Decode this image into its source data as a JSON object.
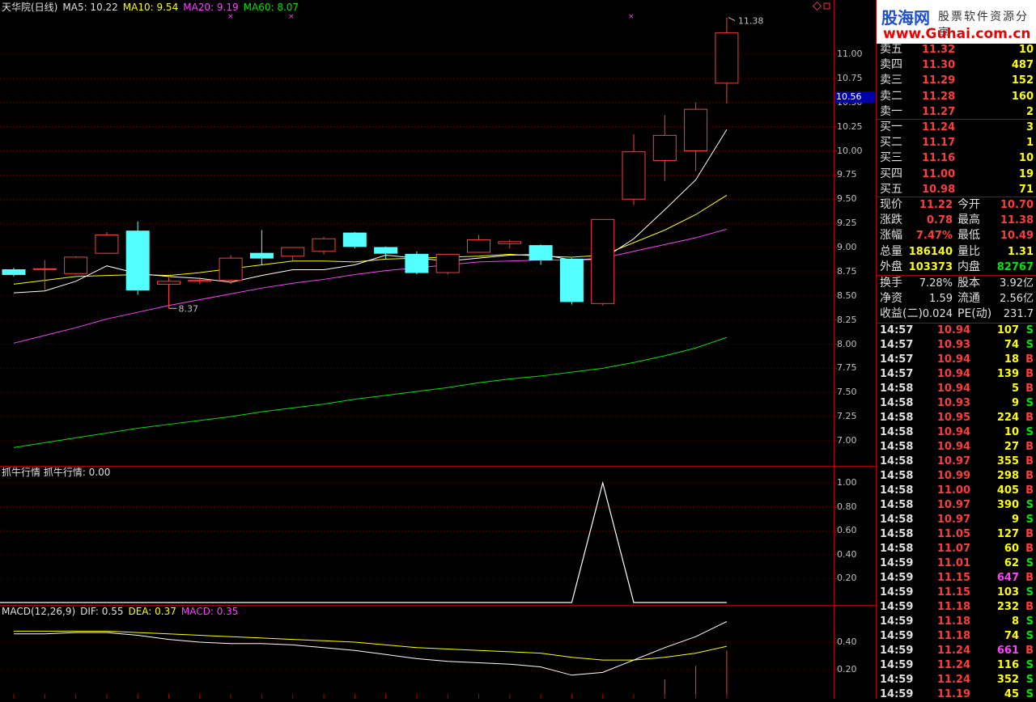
{
  "header": {
    "stock_label": "天华院(日线)",
    "ma5": "MA5: 10.22",
    "ma10": "MA10: 9.54",
    "ma20": "MA20: 9.19",
    "ma60": "MA60: 8.07"
  },
  "price_panel": {
    "y_ticks": [
      "11.00",
      "10.75",
      "10.50",
      "10.25",
      "10.00",
      "9.75",
      "9.50",
      "9.25",
      "9.00",
      "8.75",
      "8.50",
      "8.25",
      "8.00",
      "7.75",
      "7.50",
      "7.25",
      "7.00"
    ],
    "current_marker": "10.56",
    "high_label": "11.38",
    "low_label": "8.37",
    "colors": {
      "up": "#ff3c3c",
      "down": "#54ffff",
      "ma5": "#ffffff",
      "ma10": "#ffff00",
      "ma20": "#ff40ff",
      "ma60": "#00e600"
    }
  },
  "indicator_panel": {
    "title": "抓牛行情 抓牛行情: 0.00",
    "y_ticks": [
      "1.00",
      "0.80",
      "0.60",
      "0.40",
      "0.20"
    ]
  },
  "macd_panel": {
    "title_prefix": "MACD(12,26,9)",
    "dif": "DIF: 0.55",
    "dea": "DEA: 0.37",
    "macd": "MACD: 0.35",
    "y_ticks": [
      "0.40",
      "0.20"
    ]
  },
  "logo": {
    "brand": "股海网",
    "slogan": "股票软件资源分享",
    "url": "www.Guhai.com.cn"
  },
  "order_book": [
    {
      "label": "卖五",
      "price": "11.32",
      "vol": "10"
    },
    {
      "label": "卖四",
      "price": "11.30",
      "vol": "487"
    },
    {
      "label": "卖三",
      "price": "11.29",
      "vol": "152"
    },
    {
      "label": "卖二",
      "price": "11.28",
      "vol": "160"
    },
    {
      "label": "卖一",
      "price": "11.27",
      "vol": "2"
    },
    {
      "label": "买一",
      "price": "11.24",
      "vol": "3"
    },
    {
      "label": "买二",
      "price": "11.17",
      "vol": "1"
    },
    {
      "label": "买三",
      "price": "11.16",
      "vol": "10"
    },
    {
      "label": "买四",
      "price": "11.00",
      "vol": "19"
    },
    {
      "label": "买五",
      "price": "10.98",
      "vol": "71"
    }
  ],
  "stats": [
    {
      "l1": "现价",
      "v1": "11.22",
      "l2": "今开",
      "v2": "10.70"
    },
    {
      "l1": "涨跌",
      "v1": "0.78",
      "l2": "最高",
      "v2": "11.38"
    },
    {
      "l1": "涨幅",
      "v1": "7.47%",
      "l2": "最低",
      "v2": "10.49"
    },
    {
      "l1": "总量",
      "v1": "186140",
      "l2": "量比",
      "v2": "1.31"
    },
    {
      "l1": "外盘",
      "v1": "103373",
      "l2": "内盘",
      "v2": "82767"
    }
  ],
  "fundamentals": [
    {
      "l1": "换手",
      "v1": "7.28%",
      "l2": "股本",
      "v2": "3.92亿"
    },
    {
      "l1": "净资",
      "v1": "1.59",
      "l2": "流通",
      "v2": "2.56亿"
    },
    {
      "l1": "收益(二)",
      "v1": "0.024",
      "l2": "PE(动)",
      "v2": "231.7"
    }
  ],
  "ticks": [
    {
      "t": "14:57",
      "p": "10.94",
      "v": "107",
      "s": "S"
    },
    {
      "t": "14:57",
      "p": "10.93",
      "v": "74",
      "s": "S"
    },
    {
      "t": "14:57",
      "p": "10.94",
      "v": "18",
      "s": "B"
    },
    {
      "t": "14:57",
      "p": "10.94",
      "v": "139",
      "s": "B"
    },
    {
      "t": "14:58",
      "p": "10.94",
      "v": "5",
      "s": "B"
    },
    {
      "t": "14:58",
      "p": "10.93",
      "v": "9",
      "s": "S"
    },
    {
      "t": "14:58",
      "p": "10.95",
      "v": "224",
      "s": "B"
    },
    {
      "t": "14:58",
      "p": "10.94",
      "v": "10",
      "s": "S"
    },
    {
      "t": "14:58",
      "p": "10.94",
      "v": "27",
      "s": "B"
    },
    {
      "t": "14:58",
      "p": "10.97",
      "v": "355",
      "s": "B"
    },
    {
      "t": "14:58",
      "p": "10.99",
      "v": "298",
      "s": "B"
    },
    {
      "t": "14:58",
      "p": "11.00",
      "v": "405",
      "s": "B"
    },
    {
      "t": "14:58",
      "p": "10.97",
      "v": "390",
      "s": "S"
    },
    {
      "t": "14:58",
      "p": "10.97",
      "v": "9",
      "s": "S"
    },
    {
      "t": "14:58",
      "p": "11.05",
      "v": "127",
      "s": "B"
    },
    {
      "t": "14:58",
      "p": "11.07",
      "v": "60",
      "s": "B"
    },
    {
      "t": "14:59",
      "p": "11.01",
      "v": "62",
      "s": "S"
    },
    {
      "t": "14:59",
      "p": "11.15",
      "v": "647",
      "s": "B"
    },
    {
      "t": "14:59",
      "p": "11.15",
      "v": "103",
      "s": "S"
    },
    {
      "t": "14:59",
      "p": "11.18",
      "v": "232",
      "s": "B"
    },
    {
      "t": "14:59",
      "p": "11.18",
      "v": "8",
      "s": "S"
    },
    {
      "t": "14:59",
      "p": "11.18",
      "v": "74",
      "s": "S"
    },
    {
      "t": "14:59",
      "p": "11.24",
      "v": "661",
      "s": "B"
    },
    {
      "t": "14:59",
      "p": "11.24",
      "v": "116",
      "s": "S"
    },
    {
      "t": "14:59",
      "p": "11.24",
      "v": "352",
      "s": "S"
    },
    {
      "t": "14:59",
      "p": "11.19",
      "v": "45",
      "s": "S"
    }
  ],
  "candles": [
    {
      "o": 8.77,
      "c": 8.72,
      "h": 8.79,
      "l": 8.7
    },
    {
      "o": 8.78,
      "c": 8.78,
      "h": 8.87,
      "l": 8.56
    },
    {
      "o": 8.73,
      "c": 8.9,
      "h": 8.91,
      "l": 8.72
    },
    {
      "o": 8.94,
      "c": 9.13,
      "h": 9.16,
      "l": 8.94
    },
    {
      "o": 9.17,
      "c": 8.56,
      "h": 9.27,
      "l": 8.51
    },
    {
      "o": 8.62,
      "c": 8.65,
      "h": 8.69,
      "l": 8.37
    },
    {
      "o": 8.65,
      "c": 8.66,
      "h": 8.69,
      "l": 8.62
    },
    {
      "o": 8.66,
      "c": 8.89,
      "h": 8.92,
      "l": 8.62
    },
    {
      "o": 8.94,
      "c": 8.89,
      "h": 9.18,
      "l": 8.82
    },
    {
      "o": 8.91,
      "c": 9.0,
      "h": 9.0,
      "l": 8.85
    },
    {
      "o": 8.96,
      "c": 9.09,
      "h": 9.11,
      "l": 8.93
    },
    {
      "o": 9.15,
      "c": 9.01,
      "h": 9.16,
      "l": 8.99
    },
    {
      "o": 9.0,
      "c": 8.94,
      "h": 9.01,
      "l": 8.88
    },
    {
      "o": 8.93,
      "c": 8.74,
      "h": 8.96,
      "l": 8.72
    },
    {
      "o": 8.74,
      "c": 8.93,
      "h": 8.93,
      "l": 8.72
    },
    {
      "o": 8.95,
      "c": 9.08,
      "h": 9.13,
      "l": 8.95
    },
    {
      "o": 9.04,
      "c": 9.06,
      "h": 9.08,
      "l": 8.99
    },
    {
      "o": 9.02,
      "c": 8.87,
      "h": 9.03,
      "l": 8.82
    },
    {
      "o": 8.88,
      "c": 8.44,
      "h": 8.89,
      "l": 8.41
    },
    {
      "o": 8.42,
      "c": 9.29,
      "h": 9.29,
      "l": 8.4
    },
    {
      "o": 9.5,
      "c": 9.99,
      "h": 10.17,
      "l": 9.44
    },
    {
      "o": 9.9,
      "c": 10.16,
      "h": 10.37,
      "l": 9.69
    },
    {
      "o": 10.0,
      "c": 10.43,
      "h": 10.5,
      "l": 9.79
    },
    {
      "o": 10.7,
      "c": 11.22,
      "h": 11.38,
      "l": 10.49
    }
  ],
  "ma5_series": [
    8.53,
    8.55,
    8.65,
    8.81,
    8.73,
    8.7,
    8.68,
    8.64,
    8.71,
    8.77,
    8.77,
    8.82,
    8.92,
    8.89,
    8.86,
    8.89,
    8.92,
    8.93,
    8.87,
    8.88,
    9.09,
    9.39,
    9.7,
    10.22
  ],
  "ma10_series": [
    8.62,
    8.66,
    8.7,
    8.71,
    8.72,
    8.71,
    8.74,
    8.78,
    8.82,
    8.86,
    8.86,
    8.85,
    8.88,
    8.89,
    8.9,
    8.91,
    8.93,
    8.91,
    8.9,
    8.92,
    9.05,
    9.18,
    9.34,
    9.54
  ],
  "ma20_series": [
    8.01,
    8.09,
    8.17,
    8.26,
    8.33,
    8.4,
    8.46,
    8.52,
    8.58,
    8.63,
    8.67,
    8.72,
    8.76,
    8.79,
    8.82,
    8.85,
    8.86,
    8.87,
    8.87,
    8.89,
    8.96,
    9.03,
    9.1,
    9.19
  ],
  "ma60_series": [
    6.93,
    6.98,
    7.03,
    7.08,
    7.13,
    7.17,
    7.21,
    7.25,
    7.3,
    7.34,
    7.38,
    7.43,
    7.47,
    7.51,
    7.55,
    7.6,
    7.64,
    7.67,
    7.71,
    7.75,
    7.81,
    7.88,
    7.96,
    8.07
  ],
  "signal_series": [
    0,
    0,
    0,
    0,
    0,
    0,
    0,
    0,
    0,
    0,
    0,
    0,
    0,
    0,
    0,
    0,
    0,
    0,
    0,
    1,
    0,
    0,
    0,
    0
  ],
  "dif_series": [
    0.46,
    0.46,
    0.47,
    0.47,
    0.45,
    0.42,
    0.4,
    0.39,
    0.39,
    0.38,
    0.36,
    0.34,
    0.31,
    0.28,
    0.26,
    0.25,
    0.24,
    0.22,
    0.16,
    0.18,
    0.27,
    0.36,
    0.44,
    0.55
  ],
  "dea_series": [
    0.48,
    0.48,
    0.48,
    0.48,
    0.47,
    0.46,
    0.45,
    0.44,
    0.43,
    0.42,
    0.41,
    0.4,
    0.38,
    0.36,
    0.35,
    0.34,
    0.33,
    0.32,
    0.29,
    0.27,
    0.27,
    0.29,
    0.32,
    0.37
  ],
  "macd_bars": [
    -0.04,
    -0.04,
    -0.02,
    -0.02,
    -0.04,
    -0.08,
    -0.1,
    -0.1,
    -0.08,
    -0.08,
    -0.1,
    -0.12,
    -0.14,
    -0.16,
    -0.18,
    -0.18,
    -0.18,
    -0.2,
    -0.26,
    -0.18,
    0.0,
    0.14,
    0.24,
    0.35
  ]
}
